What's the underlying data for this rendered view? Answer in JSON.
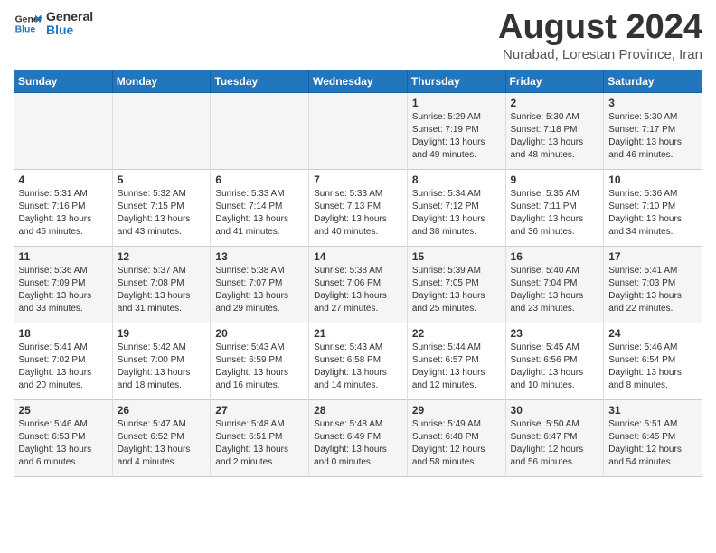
{
  "logo": {
    "line1": "General",
    "line2": "Blue"
  },
  "title": "August 2024",
  "subtitle": "Nurabad, Lorestan Province, Iran",
  "days_of_week": [
    "Sunday",
    "Monday",
    "Tuesday",
    "Wednesday",
    "Thursday",
    "Friday",
    "Saturday"
  ],
  "weeks": [
    [
      {
        "day": "",
        "info": ""
      },
      {
        "day": "",
        "info": ""
      },
      {
        "day": "",
        "info": ""
      },
      {
        "day": "",
        "info": ""
      },
      {
        "day": "1",
        "info": "Sunrise: 5:29 AM\nSunset: 7:19 PM\nDaylight: 13 hours\nand 49 minutes."
      },
      {
        "day": "2",
        "info": "Sunrise: 5:30 AM\nSunset: 7:18 PM\nDaylight: 13 hours\nand 48 minutes."
      },
      {
        "day": "3",
        "info": "Sunrise: 5:30 AM\nSunset: 7:17 PM\nDaylight: 13 hours\nand 46 minutes."
      }
    ],
    [
      {
        "day": "4",
        "info": "Sunrise: 5:31 AM\nSunset: 7:16 PM\nDaylight: 13 hours\nand 45 minutes."
      },
      {
        "day": "5",
        "info": "Sunrise: 5:32 AM\nSunset: 7:15 PM\nDaylight: 13 hours\nand 43 minutes."
      },
      {
        "day": "6",
        "info": "Sunrise: 5:33 AM\nSunset: 7:14 PM\nDaylight: 13 hours\nand 41 minutes."
      },
      {
        "day": "7",
        "info": "Sunrise: 5:33 AM\nSunset: 7:13 PM\nDaylight: 13 hours\nand 40 minutes."
      },
      {
        "day": "8",
        "info": "Sunrise: 5:34 AM\nSunset: 7:12 PM\nDaylight: 13 hours\nand 38 minutes."
      },
      {
        "day": "9",
        "info": "Sunrise: 5:35 AM\nSunset: 7:11 PM\nDaylight: 13 hours\nand 36 minutes."
      },
      {
        "day": "10",
        "info": "Sunrise: 5:36 AM\nSunset: 7:10 PM\nDaylight: 13 hours\nand 34 minutes."
      }
    ],
    [
      {
        "day": "11",
        "info": "Sunrise: 5:36 AM\nSunset: 7:09 PM\nDaylight: 13 hours\nand 33 minutes."
      },
      {
        "day": "12",
        "info": "Sunrise: 5:37 AM\nSunset: 7:08 PM\nDaylight: 13 hours\nand 31 minutes."
      },
      {
        "day": "13",
        "info": "Sunrise: 5:38 AM\nSunset: 7:07 PM\nDaylight: 13 hours\nand 29 minutes."
      },
      {
        "day": "14",
        "info": "Sunrise: 5:38 AM\nSunset: 7:06 PM\nDaylight: 13 hours\nand 27 minutes."
      },
      {
        "day": "15",
        "info": "Sunrise: 5:39 AM\nSunset: 7:05 PM\nDaylight: 13 hours\nand 25 minutes."
      },
      {
        "day": "16",
        "info": "Sunrise: 5:40 AM\nSunset: 7:04 PM\nDaylight: 13 hours\nand 23 minutes."
      },
      {
        "day": "17",
        "info": "Sunrise: 5:41 AM\nSunset: 7:03 PM\nDaylight: 13 hours\nand 22 minutes."
      }
    ],
    [
      {
        "day": "18",
        "info": "Sunrise: 5:41 AM\nSunset: 7:02 PM\nDaylight: 13 hours\nand 20 minutes."
      },
      {
        "day": "19",
        "info": "Sunrise: 5:42 AM\nSunset: 7:00 PM\nDaylight: 13 hours\nand 18 minutes."
      },
      {
        "day": "20",
        "info": "Sunrise: 5:43 AM\nSunset: 6:59 PM\nDaylight: 13 hours\nand 16 minutes."
      },
      {
        "day": "21",
        "info": "Sunrise: 5:43 AM\nSunset: 6:58 PM\nDaylight: 13 hours\nand 14 minutes."
      },
      {
        "day": "22",
        "info": "Sunrise: 5:44 AM\nSunset: 6:57 PM\nDaylight: 13 hours\nand 12 minutes."
      },
      {
        "day": "23",
        "info": "Sunrise: 5:45 AM\nSunset: 6:56 PM\nDaylight: 13 hours\nand 10 minutes."
      },
      {
        "day": "24",
        "info": "Sunrise: 5:46 AM\nSunset: 6:54 PM\nDaylight: 13 hours\nand 8 minutes."
      }
    ],
    [
      {
        "day": "25",
        "info": "Sunrise: 5:46 AM\nSunset: 6:53 PM\nDaylight: 13 hours\nand 6 minutes."
      },
      {
        "day": "26",
        "info": "Sunrise: 5:47 AM\nSunset: 6:52 PM\nDaylight: 13 hours\nand 4 minutes."
      },
      {
        "day": "27",
        "info": "Sunrise: 5:48 AM\nSunset: 6:51 PM\nDaylight: 13 hours\nand 2 minutes."
      },
      {
        "day": "28",
        "info": "Sunrise: 5:48 AM\nSunset: 6:49 PM\nDaylight: 13 hours\nand 0 minutes."
      },
      {
        "day": "29",
        "info": "Sunrise: 5:49 AM\nSunset: 6:48 PM\nDaylight: 12 hours\nand 58 minutes."
      },
      {
        "day": "30",
        "info": "Sunrise: 5:50 AM\nSunset: 6:47 PM\nDaylight: 12 hours\nand 56 minutes."
      },
      {
        "day": "31",
        "info": "Sunrise: 5:51 AM\nSunset: 6:45 PM\nDaylight: 12 hours\nand 54 minutes."
      }
    ]
  ]
}
